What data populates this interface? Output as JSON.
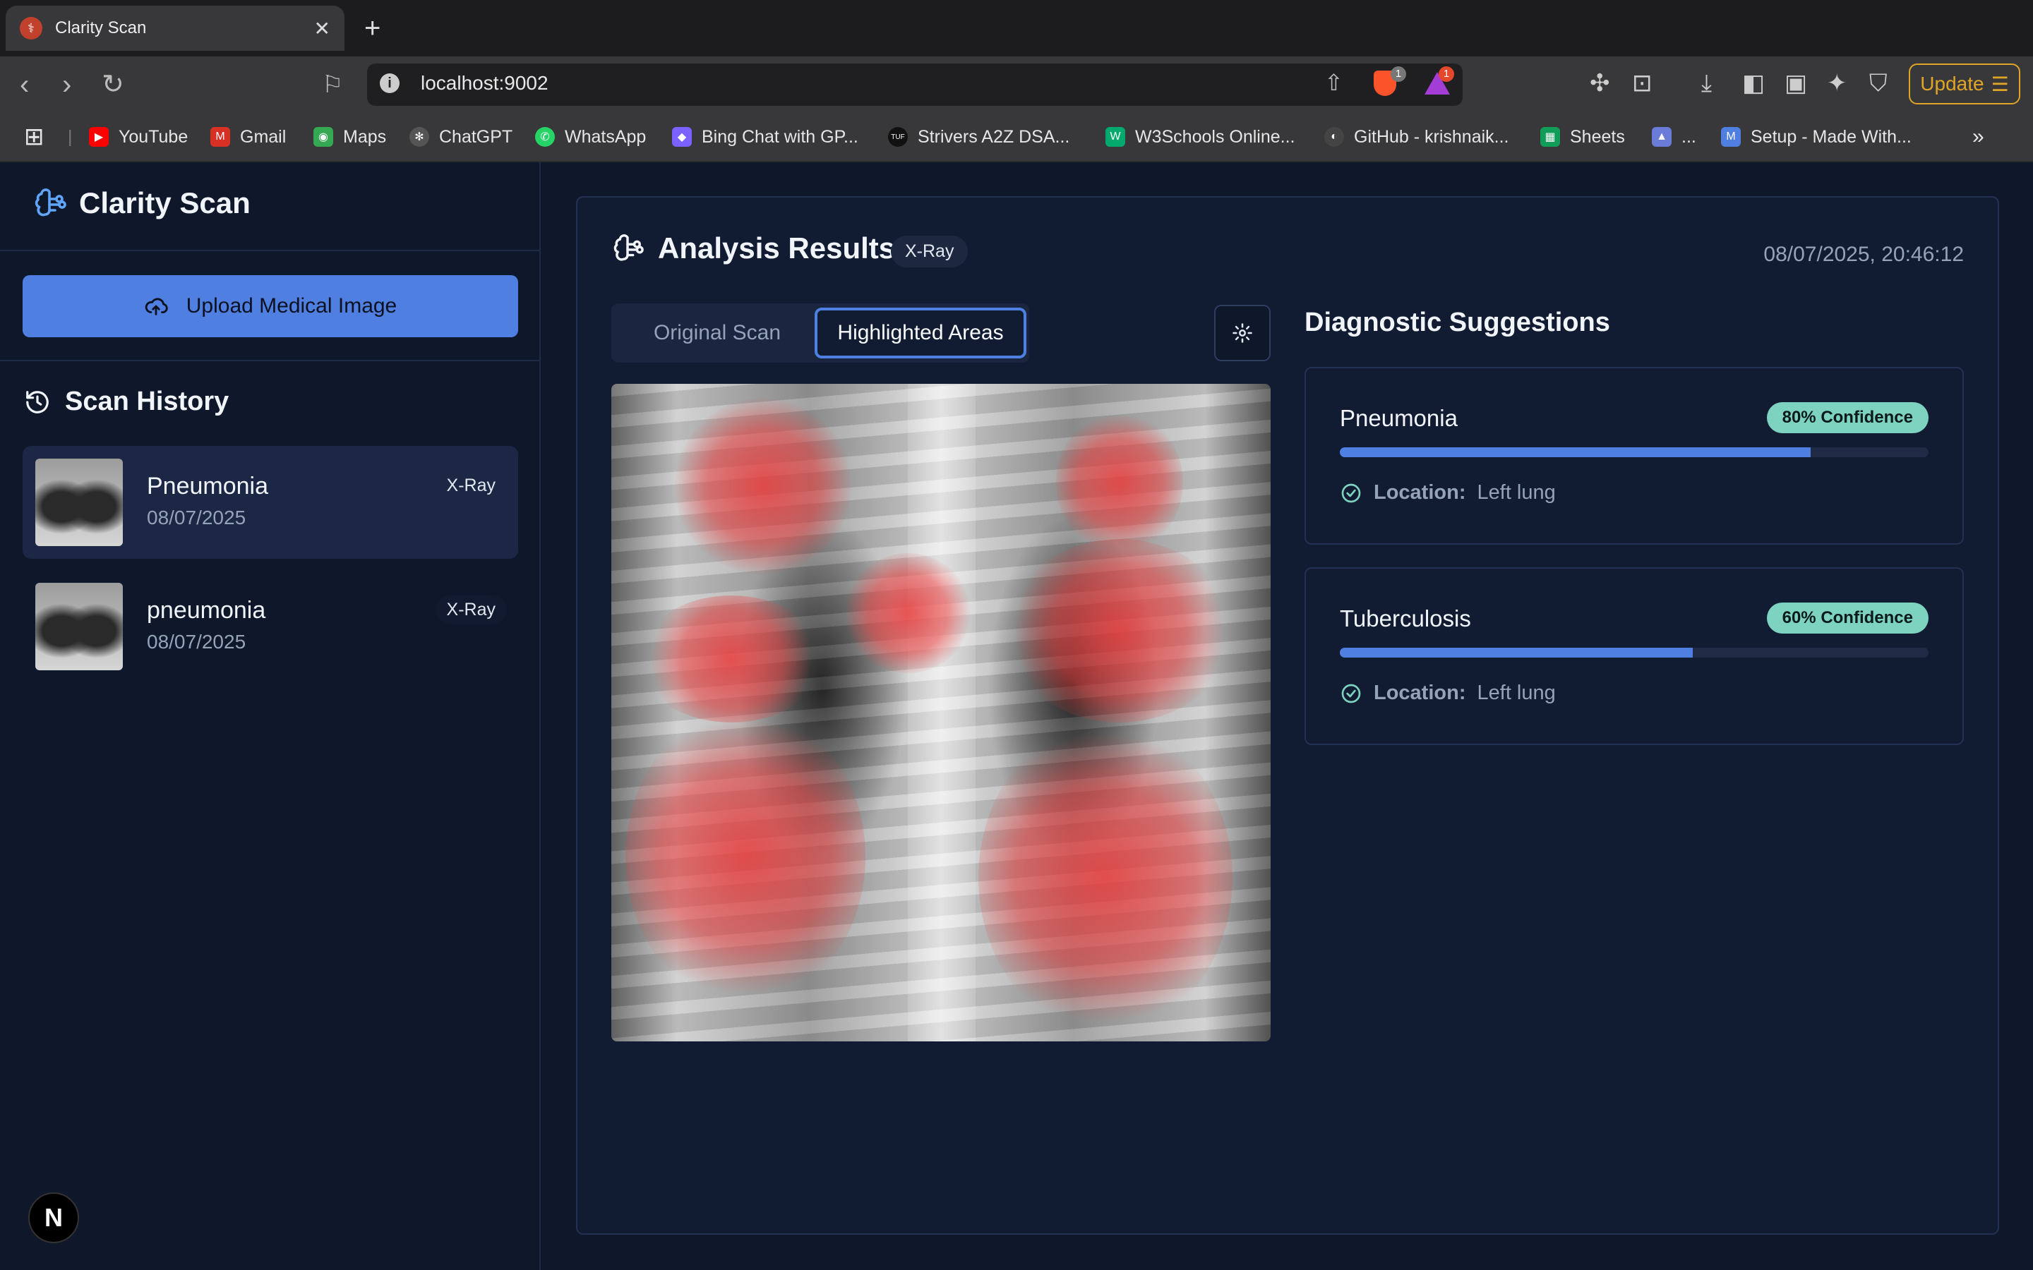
{
  "browser": {
    "tab_title": "Clarity Scan",
    "url": "localhost:9002",
    "update_label": "Update",
    "brave_shield_count": "1",
    "rewards_count": "1",
    "bookmarks": [
      {
        "label": "YouTube",
        "color": "#ff0000"
      },
      {
        "label": "Gmail",
        "color": "#d93025"
      },
      {
        "label": "Maps",
        "color": "#34a853"
      },
      {
        "label": "ChatGPT",
        "color": "#555555"
      },
      {
        "label": "WhatsApp",
        "color": "#25d366"
      },
      {
        "label": "Bing Chat with GP...",
        "color": "#7b61ff"
      },
      {
        "label": "Strivers A2Z DSA...",
        "color": "#111111"
      },
      {
        "label": "W3Schools Online...",
        "color": "#04aa6d"
      },
      {
        "label": "GitHub - krishnaik...",
        "color": "#444444"
      },
      {
        "label": "Sheets",
        "color": "#0f9d58"
      },
      {
        "label": "...",
        "color": "#6a7bd8"
      },
      {
        "label": "Setup - Made With...",
        "color": "#4f7fe0"
      }
    ]
  },
  "app": {
    "name": "Clarity Scan",
    "upload_label": "Upload Medical Image",
    "history_title": "Scan History",
    "history": [
      {
        "name": "Pneumonia",
        "date": "08/07/2025",
        "type": "X-Ray"
      },
      {
        "name": "pneumonia",
        "date": "08/07/2025",
        "type": "X-Ray"
      }
    ]
  },
  "results": {
    "title": "Analysis Results",
    "modality": "X-Ray",
    "timestamp": "08/07/2025, 20:46:12",
    "tabs": [
      "Original Scan",
      "Highlighted Areas"
    ],
    "active_tab": "Highlighted Areas",
    "diagnostic_title": "Diagnostic Suggestions",
    "suggestions": [
      {
        "name": "Pneumonia",
        "confidence_label": "80% Confidence",
        "confidence": 0.8,
        "location_label": "Location:",
        "location": "Left lung"
      },
      {
        "name": "Tuberculosis",
        "confidence_label": "60% Confidence",
        "confidence": 0.6,
        "location_label": "Location:",
        "location": "Left lung"
      }
    ]
  },
  "colors": {
    "accent": "#4f7fe0",
    "confidence_badge": "#7dd3c0",
    "background": "#0f172a"
  }
}
